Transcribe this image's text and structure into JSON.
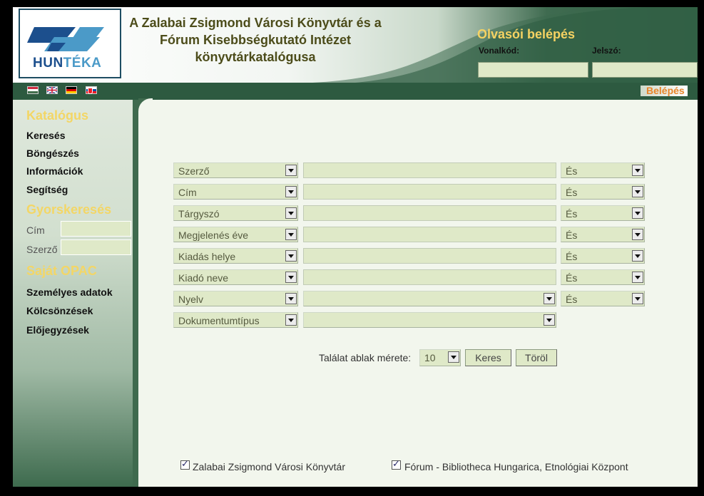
{
  "header": {
    "logo": {
      "hun": "HUN",
      "teka": "TÉKA"
    },
    "library_title": [
      "A Zalabai Zsigmond Városi Könyvtár és a",
      "Fórum Kisebbségkutató Intézet",
      "könyvtárkatalógusa"
    ],
    "login": {
      "title": "Olvasói belépés",
      "barcode_label": "Vonalkód:",
      "password_label": "Jelszó:"
    }
  },
  "flagbar": {
    "flags": [
      "hungarian-flag-icon",
      "english-flag-icon",
      "german-flag-icon",
      "slovak-flag-icon"
    ],
    "login_link": "Belépés"
  },
  "sidebar": {
    "catalog_heading": "Katalógus",
    "catalog_items": [
      "Keresés",
      "Böngészés",
      "Információk",
      "Segítség"
    ],
    "quick_heading": "Gyorskeresés",
    "quick_fields": [
      "Cím",
      "Szerző"
    ],
    "opac_heading": "Saját OPAC",
    "opac_items": [
      "Személyes adatok",
      "Kölcsönzések",
      "Előjegyzések"
    ]
  },
  "search": {
    "rows": [
      {
        "field": "Szerző",
        "operator": "És"
      },
      {
        "field": "Cím",
        "operator": "És"
      },
      {
        "field": "Tárgyszó",
        "operator": "És"
      },
      {
        "field": "Megjelenés éve",
        "operator": "És"
      },
      {
        "field": "Kiadás helye",
        "operator": "És"
      },
      {
        "field": "Kiadó neve",
        "operator": "És"
      },
      {
        "field": "Nyelv",
        "operator": "És"
      },
      {
        "field": "Dokumentumtípus",
        "operator": ""
      }
    ],
    "results_label": "Találat ablak mérete:",
    "results_size": "10",
    "search_button": "Keres",
    "clear_button": "Töröl"
  },
  "databases": [
    {
      "label": "Zalabai Zsigmond Városi Könyvtár",
      "checked": true
    },
    {
      "label": "Fórum - Bibliotheca Hungarica, Etnológiai Központ",
      "checked": true
    }
  ],
  "colors": {
    "accent_yellow": "#f3d666",
    "dark_green": "#2d5a40",
    "field_bg": "#dfe9c8",
    "link_orange": "#e8852a"
  }
}
